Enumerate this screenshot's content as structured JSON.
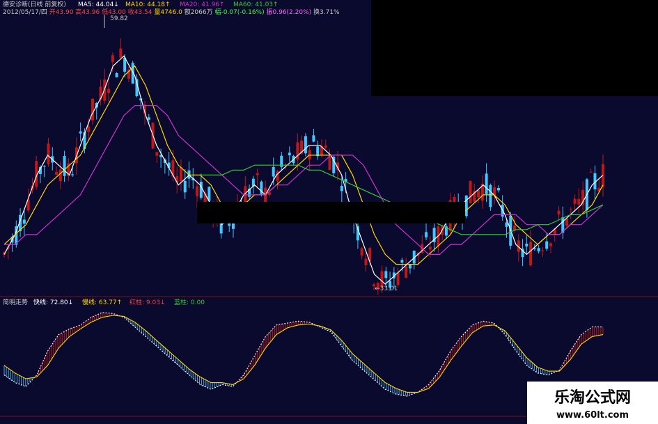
{
  "header": {
    "title": "德安诊断(日线 前复权)",
    "ma5": "MA5: 44.04↓",
    "ma10": "MA10: 44.18↑",
    "ma20": "MA20: 41.96↑",
    "ma60": "MA60: 41.03↑",
    "row2": [
      {
        "text": "2012/05/17/四",
        "color": "#c8c8c8"
      },
      {
        "text": "开43.90",
        "color": "#ff4040"
      },
      {
        "text": "高43.96",
        "color": "#ff4040"
      },
      {
        "text": "低43.00",
        "color": "#ff4040"
      },
      {
        "text": "收43.54",
        "color": "#ff4040"
      },
      {
        "text": "量4746.0",
        "color": "#ffd700"
      },
      {
        "text": "额2066万",
        "color": "#c8c8c8"
      },
      {
        "text": "幅-0.07(-0.16%)",
        "color": "#40ff40"
      },
      {
        "text": "振0.96(2.20%)",
        "color": "#ff66ff"
      },
      {
        "text": "换3.71%",
        "color": "#c8c8c8"
      }
    ]
  },
  "annotations": {
    "high": "59.82",
    "low": "←33.01"
  },
  "indicator": {
    "name": "简明走势",
    "fast": "快线: 72.80↓",
    "slow": "慢线: 63.77↑",
    "red": "红柱: 9.03↓",
    "blue": "蓝柱: 0.00"
  },
  "watermark": {
    "line1": "乐淘公式网",
    "line2": "www.60lt.com"
  },
  "colors": {
    "background": "#0a0a2e",
    "up": "#c01818",
    "down": "#40c8ff",
    "ma5": "#ffffff",
    "ma10": "#ffd700",
    "ma20": "#cc33cc",
    "ma60": "#33cc33",
    "histRed": "#c01818",
    "histBlue": "#4aa8d8",
    "fastLine": "#ffffff",
    "slowLine": "#ffd700",
    "grid": "#7a1010"
  },
  "chart_data": [
    {
      "type": "line",
      "panel": "price",
      "series": [
        {
          "name": "MA5",
          "values": [
            36,
            38,
            41,
            44,
            46,
            45,
            44,
            47,
            50,
            52,
            55,
            56,
            54,
            50,
            47,
            45,
            43,
            44,
            43,
            41,
            39,
            40,
            42,
            43,
            42,
            44,
            45,
            46,
            47,
            47,
            46,
            44,
            40,
            37,
            34,
            33,
            34,
            35,
            36,
            37,
            38,
            40,
            41,
            42,
            43,
            42,
            40,
            37,
            36,
            37,
            38,
            39,
            40,
            41,
            43,
            44
          ]
        },
        {
          "name": "MA10",
          "values": [
            37,
            38,
            39,
            41,
            43,
            44,
            45,
            46,
            48,
            50,
            52,
            54,
            55,
            53,
            50,
            47,
            45,
            44,
            44,
            43,
            41,
            40,
            41,
            42,
            42,
            43,
            44,
            45,
            46,
            46,
            46,
            46,
            44,
            41,
            38,
            36,
            35,
            35,
            35,
            36,
            37,
            38,
            40,
            41,
            42,
            42,
            41,
            39,
            38,
            37,
            38,
            38,
            39,
            40,
            41,
            43
          ]
        },
        {
          "name": "MA20",
          "values": [
            37,
            37,
            38,
            38,
            39,
            40,
            41,
            42,
            44,
            46,
            48,
            50,
            51,
            51,
            51,
            50,
            48,
            47,
            46,
            45,
            44,
            43,
            42,
            42,
            42,
            43,
            43,
            44,
            45,
            45,
            46,
            46,
            46,
            45,
            43,
            41,
            39,
            38,
            37,
            36,
            36,
            37,
            37,
            38,
            39,
            40,
            40,
            40,
            39,
            39,
            38,
            38,
            39,
            39,
            40,
            41
          ]
        },
        {
          "name": "MA60",
          "values": [
            null,
            null,
            null,
            null,
            null,
            null,
            null,
            null,
            null,
            null,
            null,
            null,
            null,
            null,
            null,
            null,
            null,
            null,
            44,
            44,
            44,
            44.5,
            44.5,
            45,
            45,
            45,
            45,
            45,
            44.5,
            44.5,
            44,
            43.5,
            43,
            42.5,
            42,
            41.5,
            41,
            40.5,
            40,
            39.5,
            39,
            38.5,
            38,
            38,
            38,
            38,
            38,
            38.5,
            38.5,
            39,
            39,
            39.5,
            40,
            40,
            40.5,
            41
          ]
        }
      ],
      "y_range": [
        33.01,
        59.82
      ]
    },
    {
      "type": "bar",
      "panel": "indicator",
      "series": [
        {
          "name": "快线",
          "values": [
            30,
            22,
            18,
            30,
            55,
            72,
            78,
            82,
            90,
            95,
            94,
            90,
            80,
            70,
            60,
            50,
            40,
            30,
            20,
            15,
            20,
            18,
            30,
            50,
            70,
            82,
            84,
            86,
            85,
            80,
            75,
            60,
            45,
            35,
            25,
            15,
            10,
            8,
            12,
            20,
            35,
            55,
            70,
            82,
            86,
            84,
            72,
            55,
            40,
            32,
            30,
            35,
            55,
            72,
            80,
            80
          ]
        },
        {
          "name": "慢线",
          "values": [
            40,
            32,
            26,
            28,
            40,
            58,
            70,
            78,
            85,
            90,
            92,
            91,
            85,
            76,
            66,
            56,
            46,
            36,
            28,
            22,
            22,
            20,
            26,
            40,
            58,
            72,
            79,
            82,
            83,
            81,
            77,
            66,
            52,
            42,
            32,
            22,
            16,
            12,
            12,
            16,
            28,
            45,
            60,
            74,
            81,
            82,
            76,
            62,
            48,
            38,
            34,
            34,
            46,
            62,
            70,
            72
          ]
        }
      ],
      "y_range": [
        0,
        100
      ]
    }
  ]
}
